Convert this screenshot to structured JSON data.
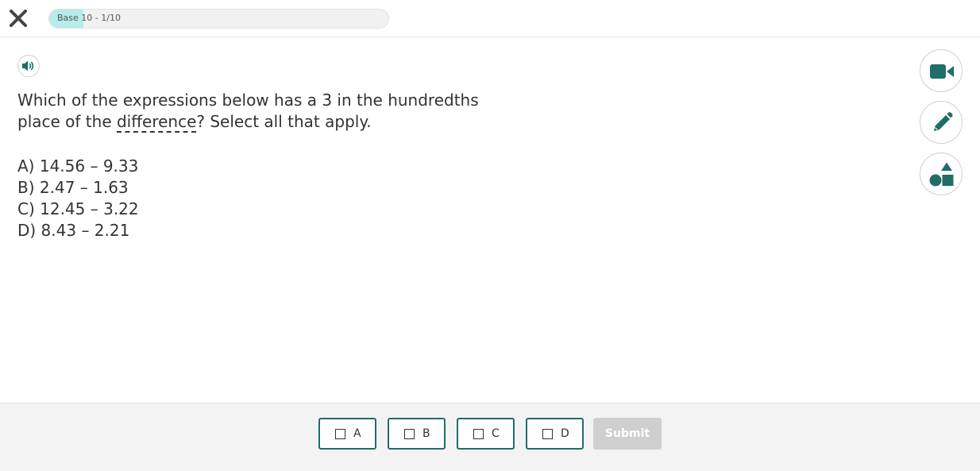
{
  "header": {
    "close_icon": "close-icon",
    "progress": {
      "label": "Base 10 - 1/10",
      "fraction": 0.1
    }
  },
  "audio": {
    "icon": "speaker-icon"
  },
  "question": {
    "text_before": "Which of the expressions below has a 3 in the hundredths place of the ",
    "term": "difference",
    "text_after": "? Select all that apply."
  },
  "options": [
    {
      "text": "A) 14.56 – 9.33"
    },
    {
      "text": "B) 2.47 – 1.63"
    },
    {
      "text": "C) 12.45 – 3.22"
    },
    {
      "text": "D) 8.43 – 2.21"
    }
  ],
  "tools": [
    {
      "icon": "video-camera-icon"
    },
    {
      "icon": "pencil-icon"
    },
    {
      "icon": "shapes-icon"
    }
  ],
  "footer": {
    "answers": [
      {
        "label": "A"
      },
      {
        "label": "B"
      },
      {
        "label": "C"
      },
      {
        "label": "D"
      }
    ],
    "submit_label": "Submit"
  },
  "colors": {
    "accent": "#1f6e68",
    "progress_fill": "#b6ecea",
    "submit_disabled": "#cfcfcf"
  }
}
